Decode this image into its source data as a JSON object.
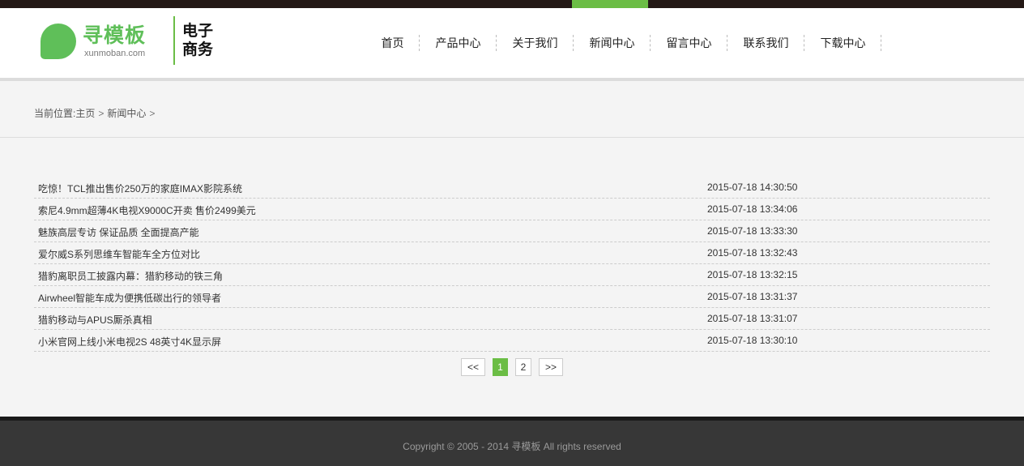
{
  "brand": {
    "logo_cn": "寻模板",
    "logo_en": "xunmoban.com",
    "slogan_line1": "电子",
    "slogan_line2": "商务",
    "accent_color": "#6bbd45"
  },
  "nav": {
    "active_index": 3,
    "items": [
      {
        "label": "首页"
      },
      {
        "label": "产品中心"
      },
      {
        "label": "关于我们"
      },
      {
        "label": "新闻中心"
      },
      {
        "label": "留言中心"
      },
      {
        "label": "联系我们"
      },
      {
        "label": "下载中心"
      }
    ]
  },
  "breadcrumb": {
    "prefix": "当前位置:",
    "home": "主页",
    "sep": ">",
    "current": "新闻中心"
  },
  "news": [
    {
      "title": "吃惊！TCL推出售价250万的家庭IMAX影院系统",
      "date": "2015-07-18 14:30:50"
    },
    {
      "title": "索尼4.9mm超薄4K电视X9000C开卖 售价2499美元",
      "date": "2015-07-18 13:34:06"
    },
    {
      "title": "魅族高层专访 保证品质 全面提高产能",
      "date": "2015-07-18 13:33:30"
    },
    {
      "title": "爱尔威S系列思维车智能车全方位对比",
      "date": "2015-07-18 13:32:43"
    },
    {
      "title": "猎豹离职员工披露内幕：猎豹移动的铁三角",
      "date": "2015-07-18 13:32:15"
    },
    {
      "title": "Airwheel智能车成为便携低碳出行的领导者",
      "date": "2015-07-18 13:31:37"
    },
    {
      "title": "猎豹移动与APUS厮杀真相",
      "date": "2015-07-18 13:31:07"
    },
    {
      "title": "小米官网上线小米电视2S 48英寸4K显示屏",
      "date": "2015-07-18 13:30:10"
    }
  ],
  "pagination": {
    "prev": "<<",
    "pages": [
      "1",
      "2"
    ],
    "current": "1",
    "next": ">>"
  },
  "footer": {
    "copyright": "Copyright © 2005 - 2014 寻模板 All rights reserved"
  }
}
